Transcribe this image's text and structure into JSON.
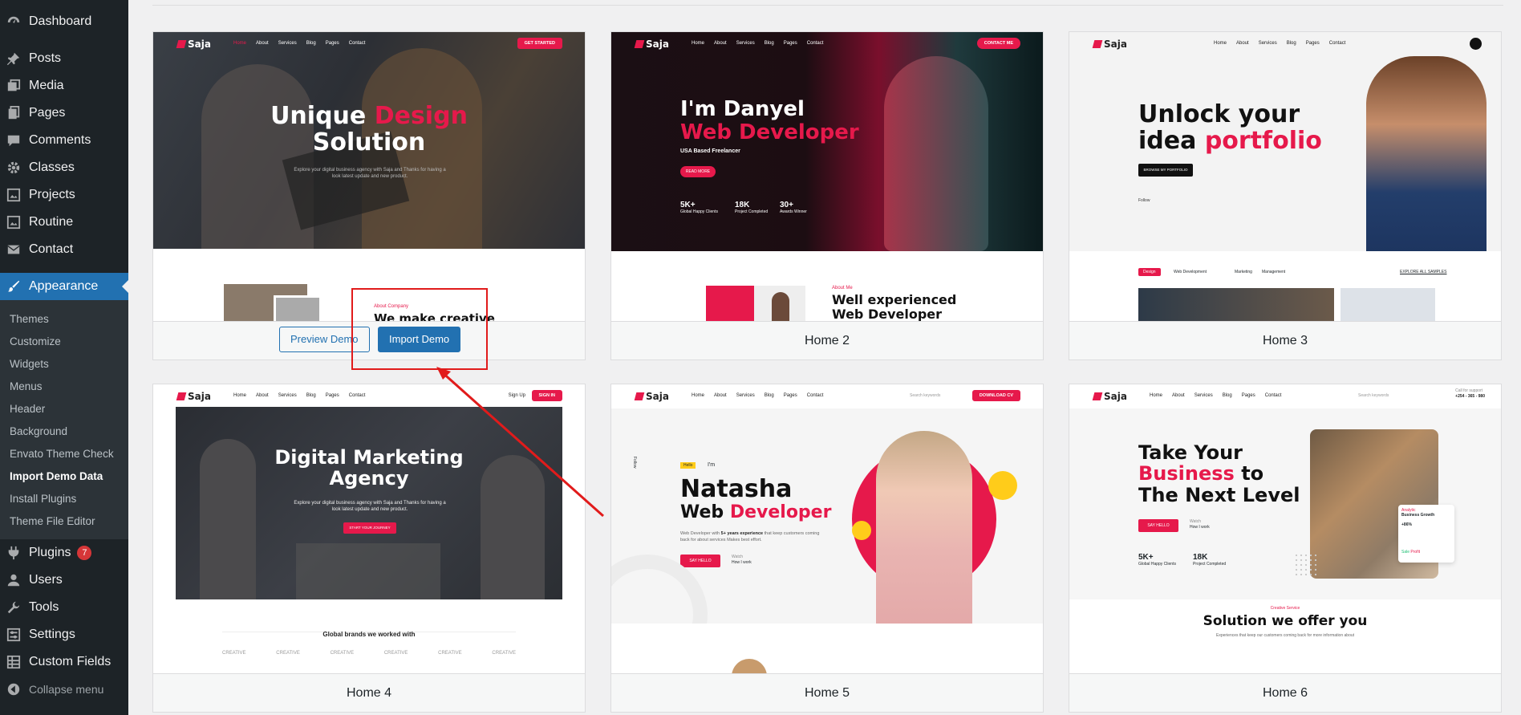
{
  "sidebar": {
    "menu": [
      {
        "label": "Dashboard",
        "icon": "dashboard-icon"
      },
      {
        "label": "Posts",
        "icon": "pin-icon"
      },
      {
        "label": "Media",
        "icon": "media-icon"
      },
      {
        "label": "Pages",
        "icon": "pages-icon"
      },
      {
        "label": "Comments",
        "icon": "comments-icon"
      },
      {
        "label": "Classes",
        "icon": "gear-icon"
      },
      {
        "label": "Projects",
        "icon": "projects-icon"
      },
      {
        "label": "Routine",
        "icon": "routine-icon"
      },
      {
        "label": "Contact",
        "icon": "mail-icon"
      },
      {
        "label": "Appearance",
        "icon": "brush-icon"
      }
    ],
    "submenu": [
      "Themes",
      "Customize",
      "Widgets",
      "Menus",
      "Header",
      "Background",
      "Envato Theme Check",
      "Import Demo Data",
      "Install Plugins",
      "Theme File Editor"
    ],
    "submenu_current": "Import Demo Data",
    "menu2": [
      {
        "label": "Plugins",
        "icon": "plugins-icon",
        "badge": "7"
      },
      {
        "label": "Users",
        "icon": "users-icon"
      },
      {
        "label": "Tools",
        "icon": "wrench-icon"
      },
      {
        "label": "Settings",
        "icon": "settings-icon"
      },
      {
        "label": "Custom Fields",
        "icon": "fields-icon"
      }
    ],
    "collapse": "Collapse menu"
  },
  "colors": {
    "accent": "#2271b1",
    "sidebar_bg": "#1d2327",
    "brand_pink": "#e6194b",
    "annotation_red": "#e11b1b"
  },
  "demos": [
    {
      "name": "",
      "preview_button": "Preview Demo",
      "import_button": "Import Demo",
      "logo": "Saja",
      "nav": [
        "Home",
        "About",
        "Services",
        "Blog",
        "Pages",
        "Contact"
      ],
      "nav_button": "GET STARTED",
      "headline": [
        "Unique",
        "Design",
        "Solution"
      ],
      "subtext": "Explore your digital business agency with Saja and Thanks for having a look latest update and new product.",
      "section_tag": "About Company",
      "section_title": "We make creative"
    },
    {
      "name": "Home 2",
      "logo": "Saja",
      "nav": [
        "Home",
        "About",
        "Services",
        "Blog",
        "Pages",
        "Contact"
      ],
      "nav_button": "CONTACT ME",
      "headline": [
        "I'm Danyel",
        "Web Developer"
      ],
      "tagline": "USA Based Freelancer",
      "cta": "READ MORE",
      "stats": [
        {
          "v": "5K+",
          "l": "Global Happy Clients"
        },
        {
          "v": "18K",
          "l": "Project Completed"
        },
        {
          "v": "30+",
          "l": "Awards Winner"
        }
      ],
      "section_tag": "About Me",
      "section_title": "Well experienced Web Developer"
    },
    {
      "name": "Home 3",
      "logo": "Saja",
      "nav": [
        "Home",
        "About",
        "Services",
        "Blog",
        "Pages",
        "Contact"
      ],
      "headline": [
        "Unlock your",
        "idea",
        "portfolio"
      ],
      "cta": "BROWSE MY PORTFOLIO",
      "follow": "Follow",
      "tabs": [
        "Design",
        "Web Development",
        "Marketing",
        "Management"
      ],
      "tabs_link": "EXPLORE ALL SAMPLES"
    },
    {
      "name": "Home 4",
      "logo": "Saja",
      "nav": [
        "Home",
        "About",
        "Services",
        "Blog",
        "Pages",
        "Contact"
      ],
      "nav_signup": "Sign Up",
      "nav_button": "SIGN IN",
      "headline": [
        "Digital Marketing",
        "Agency"
      ],
      "subtext": "Explore your digital business agency with Saja and Thanks for having a look latest update and new product.",
      "cta": "START YOUR JOURNEY",
      "brands_title": "Global brands we worked with",
      "brand": "CREATIVE"
    },
    {
      "name": "Home 5",
      "logo": "Saja",
      "nav": [
        "Home",
        "About",
        "Services",
        "Blog",
        "Pages",
        "Contact"
      ],
      "search": "Search keywords",
      "nav_button": "DOWNLOAD CV",
      "hello": "Hello",
      "im": "I'm",
      "headline": [
        "Natasha",
        "Web",
        "Developer"
      ],
      "desc_a": "Web Developer with",
      "desc_b": "5+ years experience",
      "desc_c": "that keep customers coming back for about services Makes best effort.",
      "cta": "SAY HELLO",
      "watch_label": "Watch",
      "watch": "How I work",
      "follow": "Follow"
    },
    {
      "name": "Home 6",
      "logo": "Saja",
      "nav": [
        "Home",
        "About",
        "Services",
        "Blog",
        "Pages",
        "Contact"
      ],
      "search": "Search keywords",
      "support_label": "Call for support",
      "support": "+254 - 365 - 980",
      "headline": [
        "Take Your",
        "Business",
        "to",
        "The Next Level"
      ],
      "cta": "SAY HELLO",
      "watch_label": "Watch",
      "watch": "How I work",
      "stats": [
        {
          "v": "5K+",
          "l": "Global Happy Clients"
        },
        {
          "v": "18K",
          "l": "Project Completed"
        }
      ],
      "growth_tag": "Analytic",
      "growth": "Business Growth",
      "growth_pct": "+86%",
      "legend_a": "Sale",
      "legend_b": "Profit",
      "section_tag": "Creative Service",
      "section_title": "Solution we offer you",
      "section_sub": "Experiences that keep our customers coming back for more information about"
    }
  ]
}
